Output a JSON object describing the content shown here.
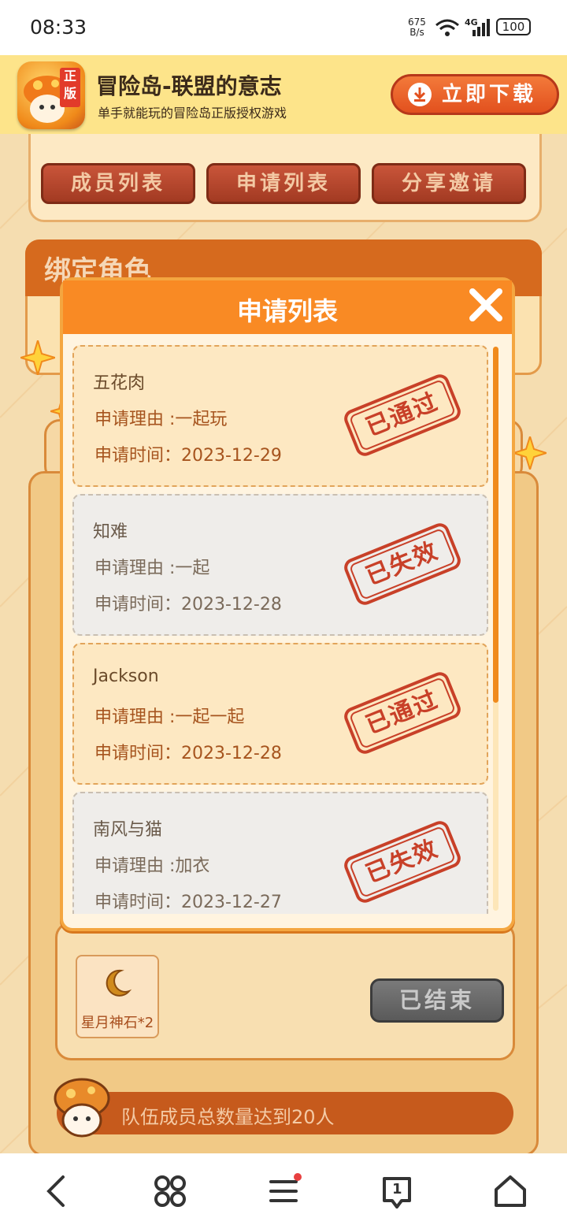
{
  "status_bar": {
    "time": "08:33",
    "net_speed_value": "675",
    "net_speed_unit": "B/s",
    "network": "4G",
    "battery": "100"
  },
  "banner": {
    "app_badge": "正版",
    "title": "冒险岛-联盟的意志",
    "subtitle": "单手就能玩的冒险岛正版授权游戏",
    "download_label": "立即下载"
  },
  "tabs": [
    {
      "label": "成员列表"
    },
    {
      "label": "申请列表"
    },
    {
      "label": "分享邀请"
    }
  ],
  "bind_section": {
    "title": "绑定角色"
  },
  "modal": {
    "title": "申请列表",
    "reason_prefix": "申请理由 :",
    "time_prefix": "申请时间：",
    "items": [
      {
        "name": "五花肉",
        "reason": "申请理由 :一起玩",
        "time": "申请时间：2023-12-29",
        "status": "已通过",
        "state": "pass"
      },
      {
        "name": "知难",
        "reason": "申请理由 :一起",
        "time": "申请时间：2023-12-28",
        "status": "已失效",
        "state": "expired"
      },
      {
        "name": "Jackson",
        "reason": "申请理由 :一起一起",
        "time": "申请时间：2023-12-28",
        "status": "已通过",
        "state": "pass"
      },
      {
        "name": "南风与猫",
        "reason": "申请理由 :加衣",
        "time": "申请时间：2023-12-27",
        "status": "已失效",
        "state": "expired"
      }
    ]
  },
  "rewards": {
    "item_label": "星月神石*2",
    "ended_button": "已结束"
  },
  "task": {
    "text": "队伍成员总数量达到20人"
  },
  "nav": {
    "tabs_count": "1"
  },
  "colors": {
    "accent": "#f98a24",
    "stamp": "#c84028",
    "banner": "#fde48a"
  }
}
